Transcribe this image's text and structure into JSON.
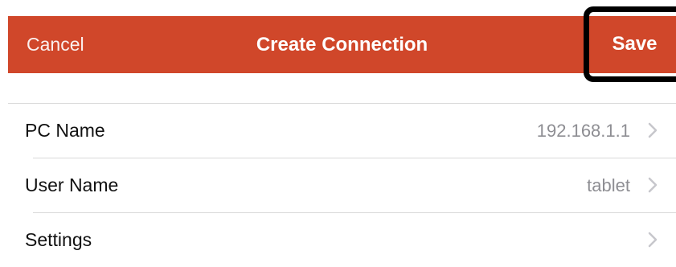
{
  "navbar": {
    "cancel_label": "Cancel",
    "title": "Create Connection",
    "save_label": "Save",
    "background_color": "#d0472a"
  },
  "rows": [
    {
      "label": "PC Name",
      "value": "192.168.1.1",
      "icon": "chevron-right-icon"
    },
    {
      "label": "User Name",
      "value": "tablet",
      "icon": "chevron-right-icon"
    },
    {
      "label": "Settings",
      "value": "",
      "icon": "chevron-right-icon"
    }
  ]
}
